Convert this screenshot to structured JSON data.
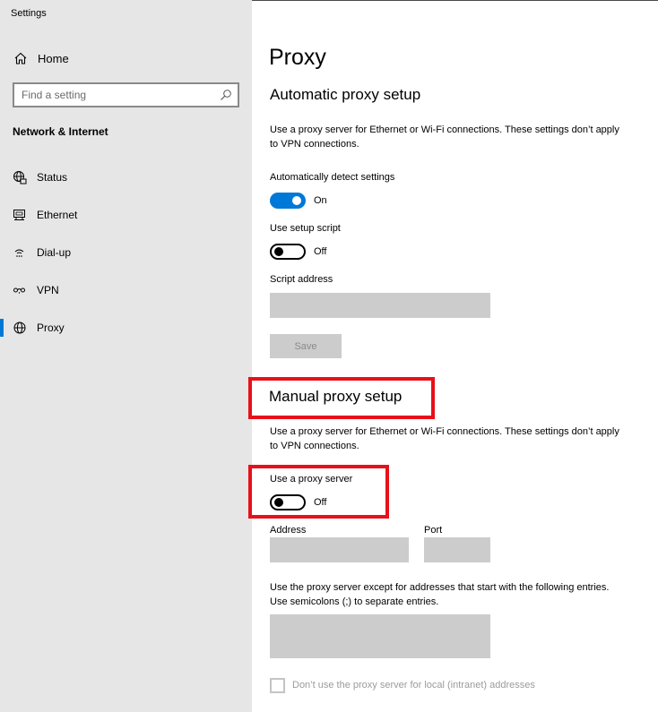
{
  "app": {
    "title": "Settings"
  },
  "sidebar": {
    "home_label": "Home",
    "search_placeholder": "Find a setting",
    "section_title": "Network & Internet",
    "items": [
      {
        "label": "Status",
        "icon": "globe-status-icon"
      },
      {
        "label": "Ethernet",
        "icon": "ethernet-icon"
      },
      {
        "label": "Dial-up",
        "icon": "dial-up-icon"
      },
      {
        "label": "VPN",
        "icon": "vpn-icon"
      },
      {
        "label": "Proxy",
        "icon": "globe-icon",
        "active": true
      }
    ]
  },
  "main": {
    "title": "Proxy",
    "auto": {
      "heading": "Automatic proxy setup",
      "description": "Use a proxy server for Ethernet or Wi-Fi connections. These settings don’t apply to VPN connections.",
      "detect_label": "Automatically detect settings",
      "detect_state": "On",
      "script_label": "Use setup script",
      "script_state": "Off",
      "script_address_label": "Script address",
      "script_address_value": "",
      "save_label": "Save"
    },
    "manual": {
      "heading": "Manual proxy setup",
      "description": "Use a proxy server for Ethernet or Wi-Fi connections. These settings don’t apply to VPN connections.",
      "use_proxy_label": "Use a proxy server",
      "use_proxy_state": "Off",
      "address_label": "Address",
      "address_value": "",
      "port_label": "Port",
      "port_value": "",
      "exceptions_description": "Use the proxy server except for addresses that start with the following entries. Use semicolons (;) to separate entries.",
      "exceptions_value": "",
      "local_checkbox_label": "Don’t use the proxy server for local (intranet) addresses"
    }
  },
  "colors": {
    "accent": "#0078d7",
    "highlight": "#e8101a",
    "sidebar_bg": "#e6e6e6",
    "disabled_field": "#cccccc"
  }
}
